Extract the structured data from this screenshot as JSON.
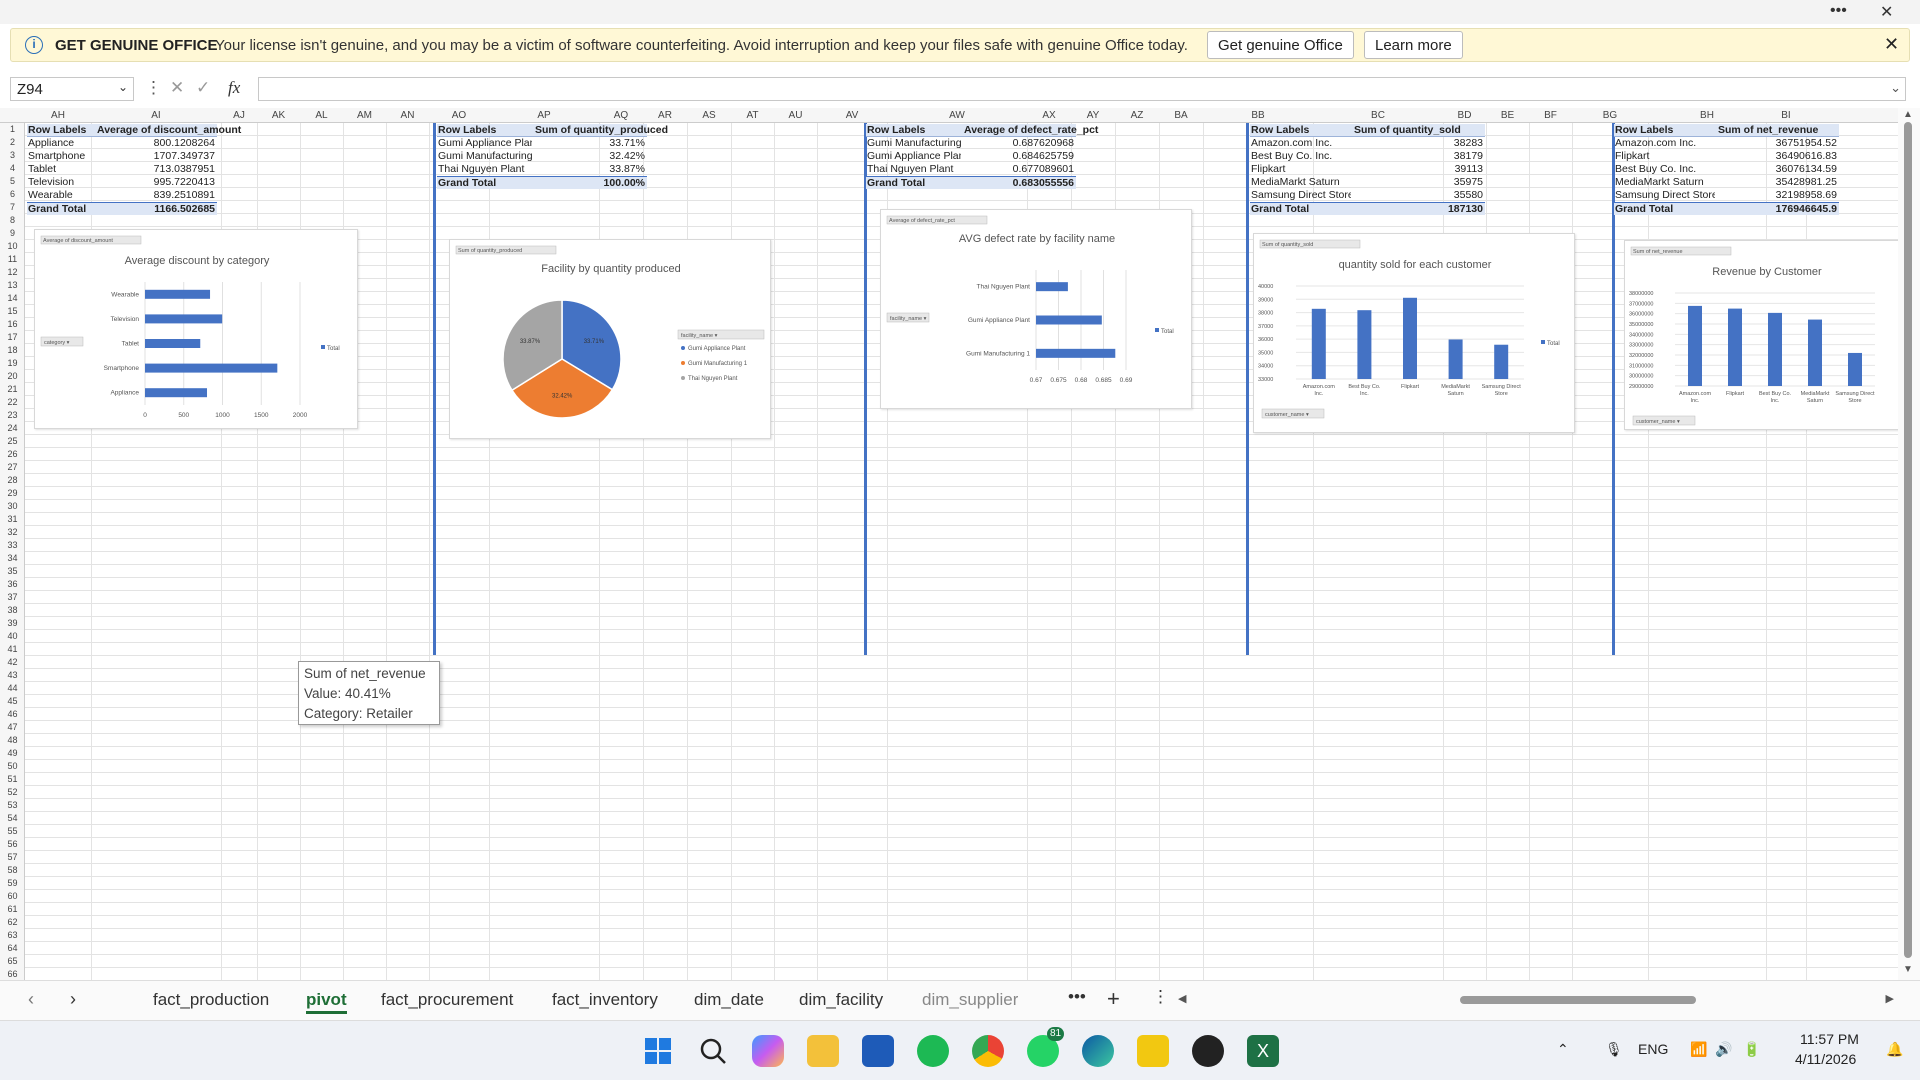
{
  "window": {
    "more": "•••",
    "close": "✕"
  },
  "banner": {
    "title": "GET GENUINE OFFICE",
    "message": "Your license isn't genuine, and you may be a victim of software counterfeiting. Avoid interruption and keep your files safe with genuine Office today.",
    "btn_genuine": "Get genuine Office",
    "btn_learn": "Learn more"
  },
  "formula_bar": {
    "name_box": "Z94",
    "fx": "fx",
    "value": ""
  },
  "columns": [
    "AH",
    "AI",
    "AJ",
    "AK",
    "AL",
    "AM",
    "AN",
    "AO",
    "AP",
    "AQ",
    "AR",
    "AS",
    "AT",
    "AU",
    "AV",
    "AW",
    "AX",
    "AY",
    "AZ",
    "BA",
    "BB",
    "BC",
    "BD",
    "BE",
    "BF",
    "BG",
    "BH",
    "BI"
  ],
  "rows": [
    "1",
    "2",
    "3",
    "4",
    "5",
    "6",
    "7",
    "8",
    "9",
    "10",
    "11",
    "12",
    "13",
    "14",
    "15",
    "16",
    "17",
    "18",
    "19",
    "20",
    "21",
    "22",
    "23",
    "24",
    "25",
    "26",
    "27",
    "28",
    "29",
    "30",
    "31",
    "32",
    "33",
    "34",
    "35",
    "36",
    "37",
    "38",
    "39",
    "40",
    "41",
    "42",
    "43",
    "44",
    "45",
    "46",
    "47",
    "48",
    "49",
    "50",
    "51",
    "52",
    "53",
    "54",
    "55",
    "56",
    "57",
    "58",
    "59",
    "60",
    "61",
    "62",
    "63",
    "64",
    "65",
    "66"
  ],
  "pivots": [
    {
      "h1": "Row Labels",
      "h2": "Average of discount_amount",
      "rows": [
        [
          "Appliance",
          "800.1208264"
        ],
        [
          "Smartphone",
          "1707.349737"
        ],
        [
          "Tablet",
          "713.0387951"
        ],
        [
          "Television",
          "995.7220413"
        ],
        [
          "Wearable",
          "839.2510891"
        ]
      ],
      "total": [
        "Grand Total",
        "1166.502685"
      ]
    },
    {
      "h1": "Row Labels",
      "h2": "Sum of quantity_produced",
      "rows": [
        [
          "Gumi Appliance Plant",
          "33.71%"
        ],
        [
          "Gumi Manufacturing 1",
          "32.42%"
        ],
        [
          "Thai Nguyen Plant",
          "33.87%"
        ]
      ],
      "total": [
        "Grand Total",
        "100.00%"
      ]
    },
    {
      "h1": "Row Labels",
      "h2": "Average of defect_rate_pct",
      "rows": [
        [
          "Gumi Manufacturing 1",
          "0.687620968"
        ],
        [
          "Gumi Appliance Plant",
          "0.684625759"
        ],
        [
          "Thai Nguyen Plant",
          "0.677089601"
        ]
      ],
      "total": [
        "Grand Total",
        "0.683055556"
      ]
    },
    {
      "h1": "Row Labels",
      "h2": "Sum of quantity_sold",
      "rows": [
        [
          "Amazon.com Inc.",
          "38283"
        ],
        [
          "Best Buy Co. Inc.",
          "38179"
        ],
        [
          "Flipkart",
          "39113"
        ],
        [
          "MediaMarkt Saturn",
          "35975"
        ],
        [
          "Samsung Direct Store",
          "35580"
        ]
      ],
      "total": [
        "Grand Total",
        "187130"
      ]
    },
    {
      "h1": "Row Labels",
      "h2": "Sum of net_revenue",
      "rows": [
        [
          "Amazon.com Inc.",
          "36751954.52"
        ],
        [
          "Flipkart",
          "36490616.83"
        ],
        [
          "Best Buy Co. Inc.",
          "36076134.59"
        ],
        [
          "MediaMarkt Saturn",
          "35428981.25"
        ],
        [
          "Samsung Direct Store",
          "32198958.69"
        ]
      ],
      "total": [
        "Grand Total",
        "176946645.9"
      ]
    }
  ],
  "chart_data": [
    {
      "type": "bar",
      "orientation": "horizontal",
      "title": "Average discount by category",
      "field_button": "Average of discount_amount",
      "filter_button": "category",
      "legend": "Total",
      "categories": [
        "Wearable",
        "Television",
        "Tablet",
        "Smartphone",
        "Appliance"
      ],
      "values": [
        839.25,
        995.72,
        713.04,
        1707.35,
        800.12
      ],
      "xticks": [
        "0",
        "500",
        "1000",
        "1500",
        "2000"
      ],
      "xlim": [
        0,
        2000
      ],
      "color": "#4472c4"
    },
    {
      "type": "pie",
      "title": "Facility by quantity produced",
      "field_button": "Sum of quantity_produced",
      "filter_button": "facility_name",
      "categories": [
        "Gumi Appliance Plant",
        "Gumi Manufacturing 1",
        "Thai Nguyen Plant"
      ],
      "values": [
        33.71,
        32.42,
        33.87
      ],
      "labels": [
        "33.71%",
        "32.42%",
        "33.87%"
      ],
      "colors": [
        "#4472c4",
        "#ed7d31",
        "#a5a5a5"
      ]
    },
    {
      "type": "bar",
      "orientation": "horizontal",
      "title": "AVG defect rate by facility name",
      "field_button": "Average of defect_rate_pct",
      "filter_button": "facility_name",
      "legend": "Total",
      "categories": [
        "Thai Nguyen Plant",
        "Gumi Appliance Plant",
        "Gumi Manufacturing 1"
      ],
      "values": [
        0.677089601,
        0.684625759,
        0.687620968
      ],
      "xticks": [
        "0.67",
        "0.675",
        "0.68",
        "0.685",
        "0.69"
      ],
      "xlim": [
        0.67,
        0.69
      ],
      "color": "#4472c4"
    },
    {
      "type": "bar",
      "orientation": "vertical",
      "title": "quantity sold for each customer",
      "field_button": "Sum of quantity_sold",
      "filter_button": "customer_name",
      "legend": "Total",
      "categories": [
        "Amazon.com Inc.",
        "Best Buy Co. Inc.",
        "Flipkart",
        "MediaMarkt Saturn",
        "Samsung Direct Store"
      ],
      "values": [
        38283,
        38179,
        39113,
        35975,
        35580
      ],
      "yticks": [
        "40000",
        "39000",
        "38000",
        "37000",
        "36000",
        "35000",
        "34000",
        "33000"
      ],
      "ylim": [
        33000,
        40000
      ],
      "color": "#4472c4"
    },
    {
      "type": "bar",
      "orientation": "vertical",
      "title": "Revenue by Customer",
      "field_button": "Sum of net_revenue",
      "filter_button": "customer_name",
      "legend": "",
      "categories": [
        "Amazon.com Inc.",
        "Flipkart",
        "Best Buy Co. Inc.",
        "MediaMarkt Saturn",
        "Samsung Direct Store"
      ],
      "values": [
        36751954.52,
        36490616.83,
        36076134.59,
        35428981.25,
        32198958.69
      ],
      "yticks": [
        "38000000",
        "37000000",
        "36000000",
        "35000000",
        "34000000",
        "33000000",
        "32000000",
        "31000000",
        "30000000",
        "29000000"
      ],
      "ylim": [
        29000000,
        38000000
      ],
      "color": "#4472c4"
    }
  ],
  "tooltip": {
    "line1": "Sum of net_revenue",
    "line2": "Value: 40.41%",
    "line3": "Category: Retailer"
  },
  "sheets": [
    "fact_production",
    "pivot",
    "fact_procurement",
    "fact_inventory",
    "dim_date",
    "dim_facility",
    "dim_supplier"
  ],
  "active_sheet": "pivot",
  "tabs_more": "•••",
  "tabs_add": "+",
  "tabs_menu": "⋮",
  "taskbar": {
    "whatsapp_badge": "81",
    "lang": "ENG",
    "time": "11:57 PM",
    "date": "4/11/2026"
  }
}
